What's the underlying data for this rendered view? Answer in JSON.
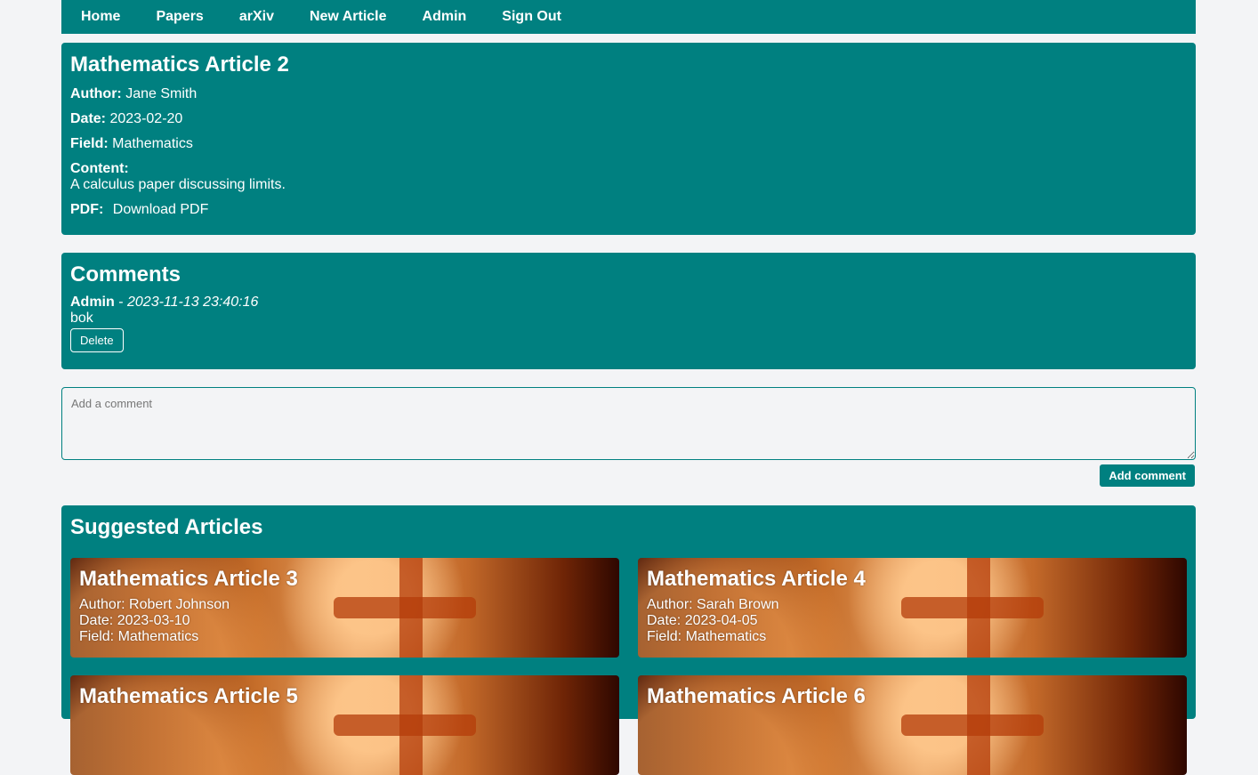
{
  "nav": {
    "items": [
      {
        "label": "Home"
      },
      {
        "label": "Papers"
      },
      {
        "label": "arXiv"
      },
      {
        "label": "New Article"
      },
      {
        "label": "Admin"
      },
      {
        "label": "Sign Out"
      }
    ]
  },
  "article": {
    "title": "Mathematics Article 2",
    "author_label": "Author:",
    "author": "Jane Smith",
    "date_label": "Date:",
    "date": "2023-02-20",
    "field_label": "Field:",
    "field": "Mathematics",
    "content_label": "Content:",
    "content": "A calculus paper discussing limits.",
    "pdf_label": "PDF:",
    "pdf_link": "Download PDF"
  },
  "comments": {
    "heading": "Comments",
    "items": [
      {
        "author": "Admin",
        "separator": " - ",
        "timestamp": "2023-11-13 23:40:16",
        "body": "bok",
        "delete_label": "Delete"
      }
    ]
  },
  "new_comment": {
    "placeholder": "Add a comment",
    "submit_label": "Add comment"
  },
  "suggested": {
    "heading": "Suggested Articles",
    "articles": [
      {
        "title": "Mathematics Article 3",
        "author": "Author: Robert Johnson",
        "date": "Date: 2023-03-10",
        "field": "Field: Mathematics"
      },
      {
        "title": "Mathematics Article 4",
        "author": "Author: Sarah Brown",
        "date": "Date: 2023-04-05",
        "field": "Field: Mathematics"
      },
      {
        "title": "Mathematics Article 5",
        "author": "",
        "date": "",
        "field": ""
      },
      {
        "title": "Mathematics Article 6",
        "author": "",
        "date": "",
        "field": ""
      }
    ]
  },
  "colors": {
    "teal": "#008080",
    "background": "#f3f4f6",
    "text": "#ffffff"
  }
}
